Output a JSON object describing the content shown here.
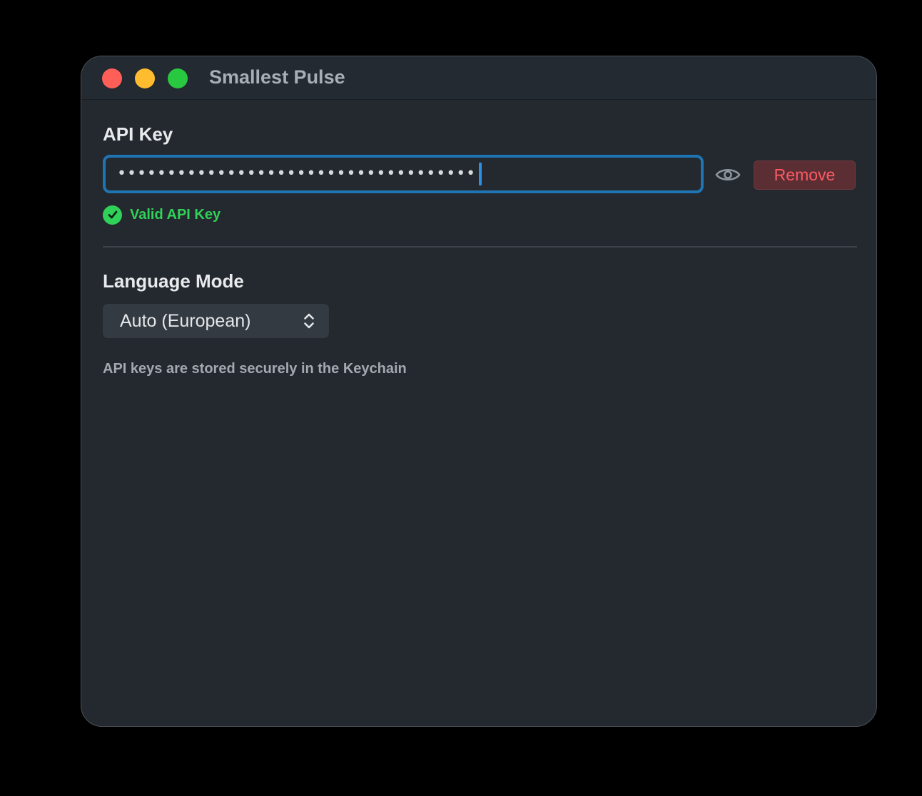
{
  "window": {
    "title": "Smallest Pulse"
  },
  "api_key": {
    "label": "API Key",
    "masked_value": "••••••••••••••••••••••••••••••••••••",
    "reveal_icon": "eye-icon",
    "remove_label": "Remove",
    "status_icon": "checkmark-circle-icon",
    "status_text": "Valid API Key"
  },
  "language": {
    "label": "Language Mode",
    "selected": "Auto (European)",
    "select_icon": "chevron-up-down-icon"
  },
  "footnote": "API keys are stored securely in the Keychain",
  "colors": {
    "accent": "#1f74b3",
    "success": "#30d158",
    "danger": "#ff5a63",
    "close": "#ff5f57",
    "minimize": "#febc2e",
    "maximize": "#28c840"
  }
}
